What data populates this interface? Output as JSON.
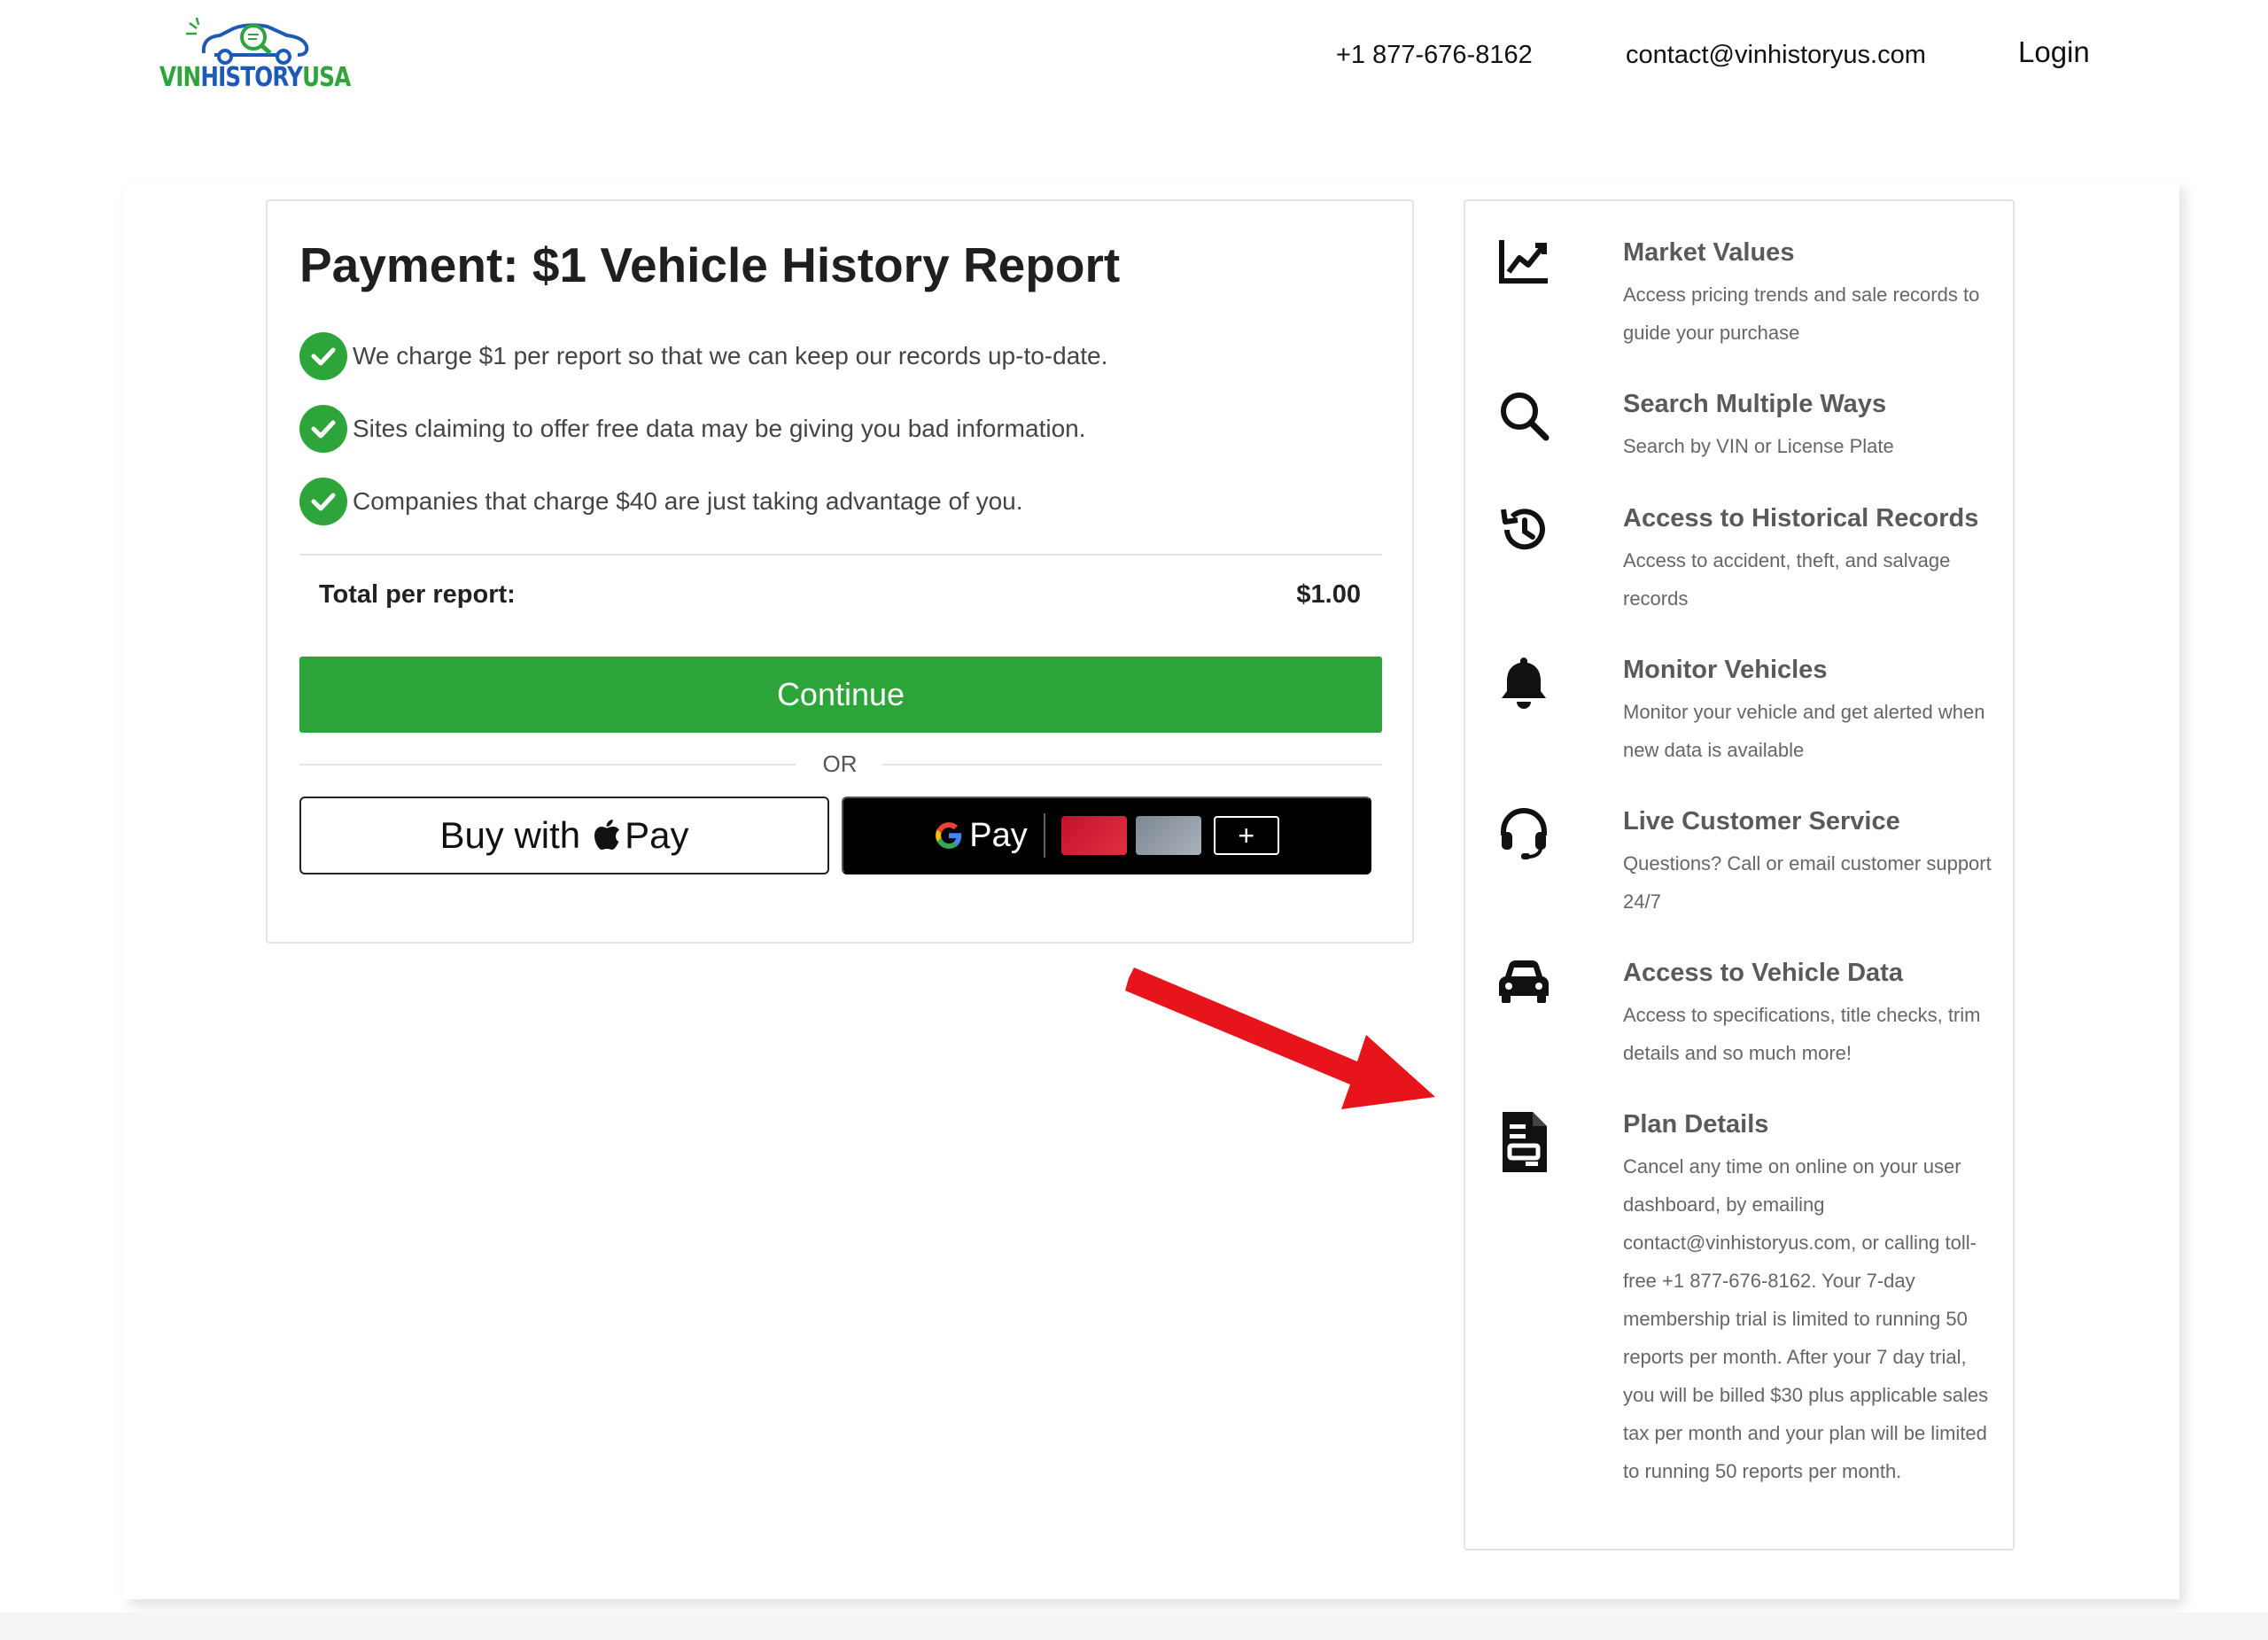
{
  "brand": {
    "logo_part1": "VIN",
    "logo_part2": "HISTORY",
    "logo_part3": "USA",
    "colors": {
      "green": "#2ea53a",
      "blue": "#1d5ab5"
    }
  },
  "nav": {
    "phone": "+1 877-676-8162",
    "email": "contact@vinhistoryus.com",
    "login": "Login"
  },
  "payment": {
    "title": "Payment: $1 Vehicle History Report",
    "points": [
      "We charge $1 per report so that we can keep our records up-to-date.",
      "Sites claiming to offer free data may be giving you bad information.",
      "Companies that charge $40 are just taking advantage of you."
    ],
    "total_label": "Total per report:",
    "total_value": "$1.00",
    "continue_label": "Continue",
    "or_label": "OR",
    "apple_pay_prefix": "Buy with",
    "apple_pay_suffix": "Pay",
    "gpay_label": "Pay",
    "gpay_add": "+"
  },
  "features": [
    {
      "icon": "chart-line-icon",
      "title": "Market Values",
      "desc": "Access pricing trends and sale records to guide your purchase"
    },
    {
      "icon": "search-icon",
      "title": "Search Multiple Ways",
      "desc": "Search by VIN or License Plate"
    },
    {
      "icon": "history-icon",
      "title": "Access to Historical Records",
      "desc": "Access to accident, theft, and salvage records"
    },
    {
      "icon": "bell-icon",
      "title": "Monitor Vehicles",
      "desc": "Monitor your vehicle and get alerted when new data is available"
    },
    {
      "icon": "headset-icon",
      "title": "Live Customer Service",
      "desc": "Questions? Call or email customer support 24/7"
    },
    {
      "icon": "car-icon",
      "title": "Access to Vehicle Data",
      "desc": "Access to specifications, title checks, trim details and so much more!"
    },
    {
      "icon": "document-icon",
      "title": "Plan Details",
      "desc": "Cancel any time on online on your user dashboard, by emailing contact@vinhistoryus.com, or calling toll-free +1 877-676-8162. Your 7-day membership trial is limited to running 50 reports per month. After your 7 day trial, you will be billed $30 plus applicable sales tax per month and your plan will be limited to running 50 reports per month."
    }
  ],
  "colors": {
    "accent_green": "#2ea53a",
    "arrow_red": "#e8141b",
    "border": "#e3e3e3"
  }
}
